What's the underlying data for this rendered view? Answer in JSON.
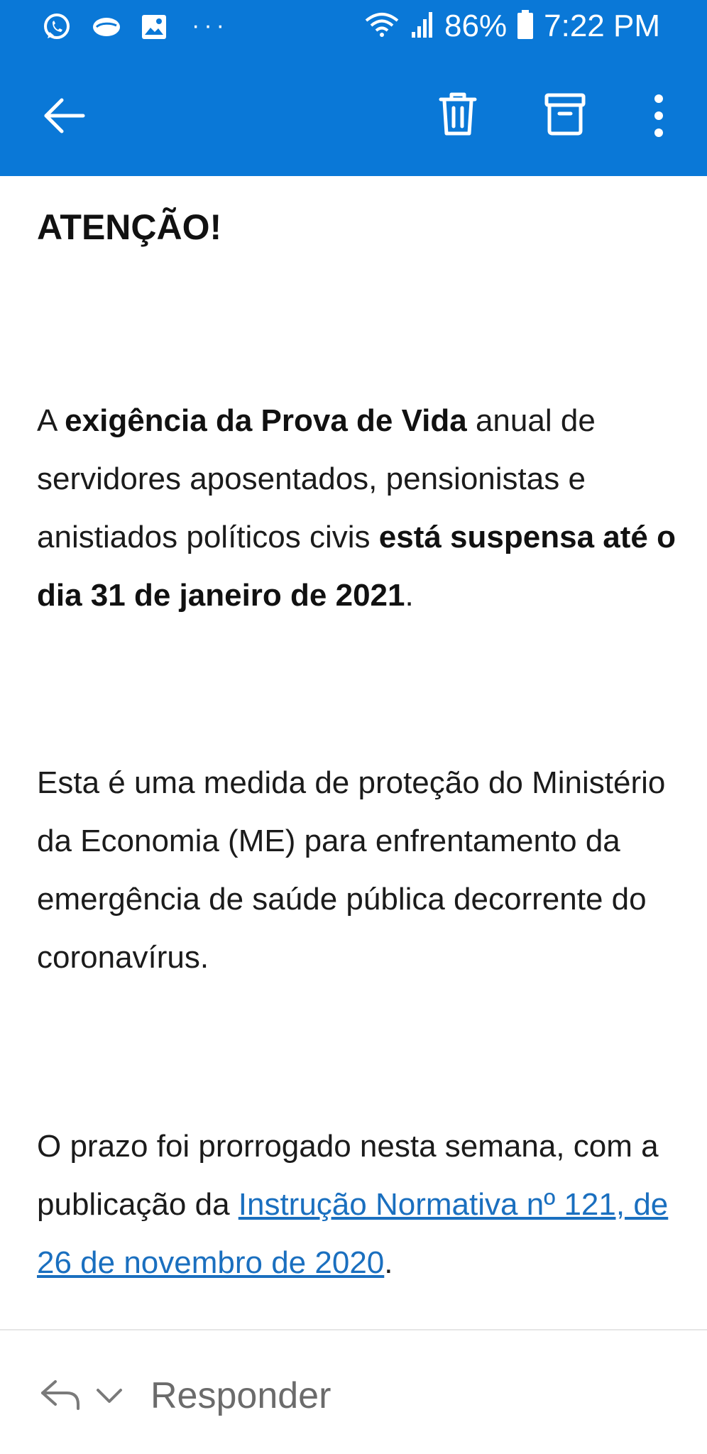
{
  "status_bar": {
    "battery": "86%",
    "time": "7:22 PM",
    "more_notifications": "···",
    "notification_icons": [
      "whatsapp-icon",
      "chat-bubbles-icon",
      "gallery-icon"
    ],
    "right_icons": [
      "wifi-icon",
      "signal-icon",
      "battery-icon"
    ]
  },
  "toolbar": {
    "icons": [
      "back-arrow-icon",
      "trash-icon",
      "archive-icon",
      "more-vertical-icon"
    ],
    "accent_color": "#0a78d7"
  },
  "email": {
    "heading": "ATENÇÃO!",
    "p1": {
      "t1": "A ",
      "b1": "exigência da Prova de Vida",
      "t2": " anual de servidores aposentados, pensionistas e anistiados políticos civis ",
      "b2": "está suspensa até o dia 31 de janeiro de 2021",
      "t3": "."
    },
    "p2": "Esta é uma medida de proteção do Ministério da Economia (ME) para enfrentamento da emergência de saúde pública decorrente do coronavírus.",
    "p3": {
      "t1": "O prazo foi prorrogado nesta semana, com a publicação da ",
      "link": "Instrução Normativa nº 121, de 26 de novembro de 2020",
      "t2": "."
    }
  },
  "reply_bar": {
    "label": "Responder",
    "icons": [
      "reply-arrow-icon",
      "chevron-down-icon"
    ]
  }
}
